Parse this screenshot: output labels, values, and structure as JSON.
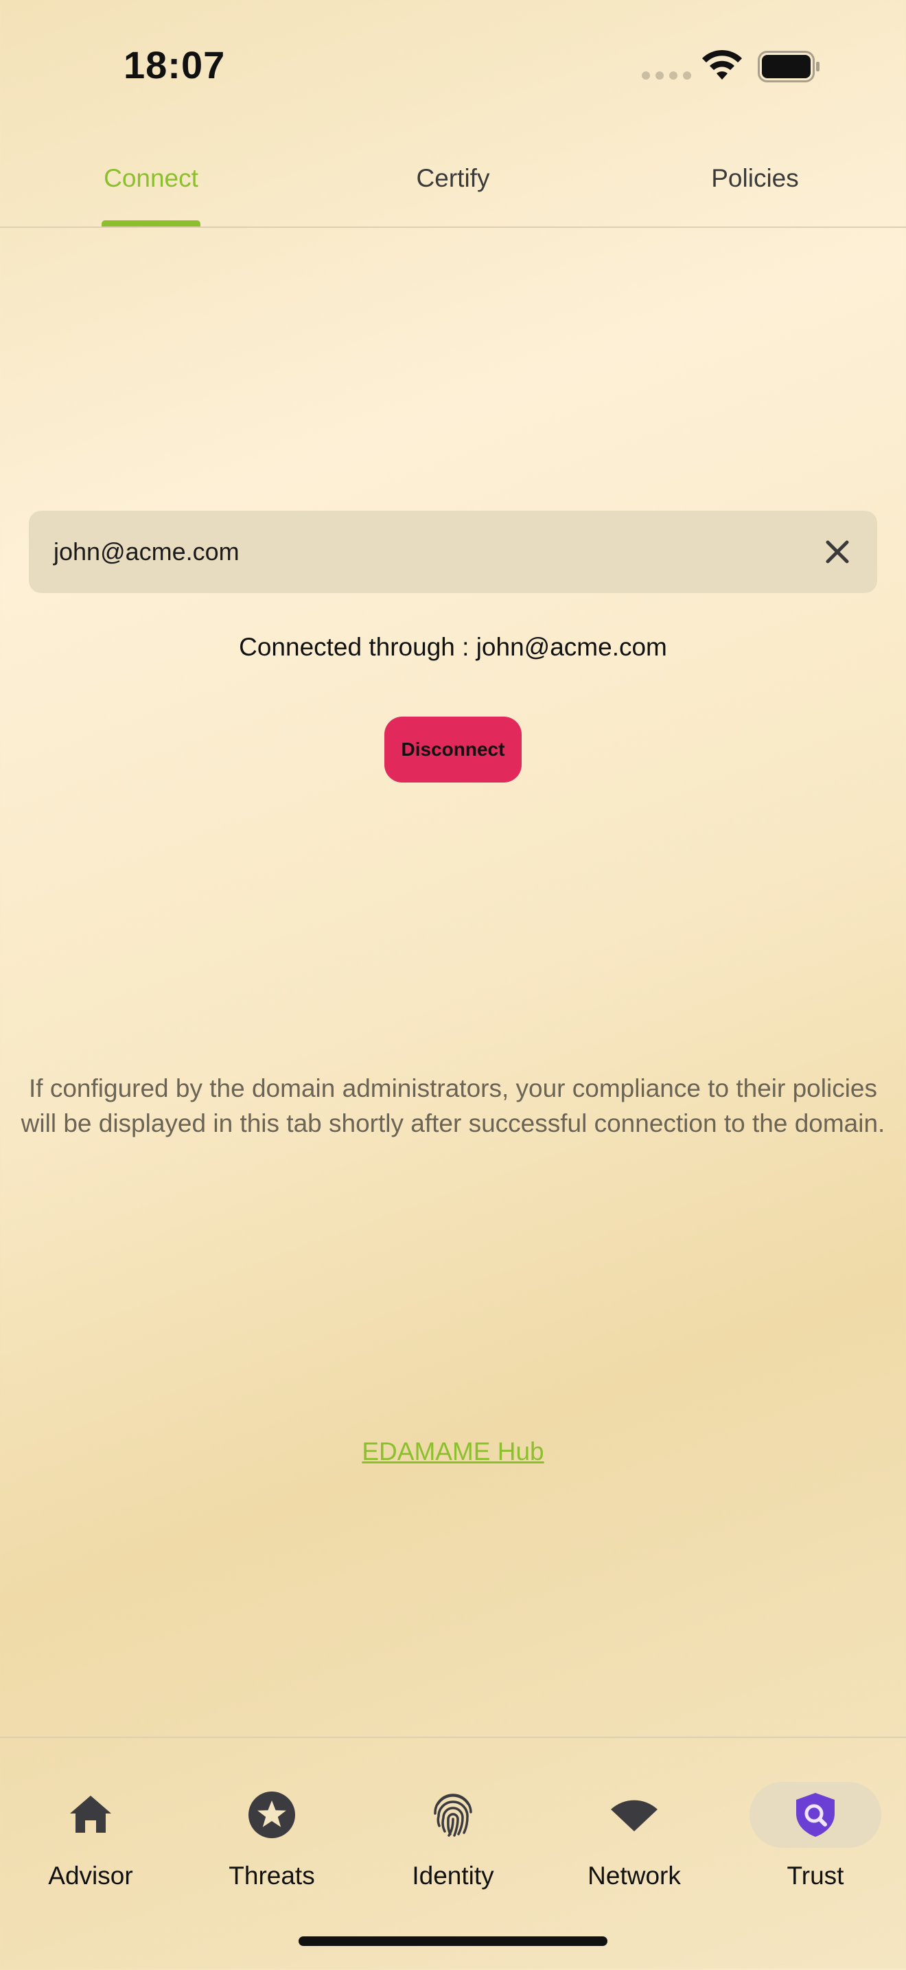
{
  "status_bar": {
    "time": "18:07"
  },
  "top_tabs": [
    {
      "label": "Connect",
      "active": true
    },
    {
      "label": "Certify",
      "active": false
    },
    {
      "label": "Policies",
      "active": false
    }
  ],
  "connect": {
    "email_value": "john@acme.com",
    "connected_text": "Connected through : john@acme.com",
    "disconnect_label": "Disconnect",
    "info_text": "If configured by the domain administrators, your compliance to their policies will be displayed in this tab shortly after successful connection to the domain.",
    "hub_link": "EDAMAME Hub"
  },
  "bottom_nav": [
    {
      "label": "Advisor",
      "icon": "home-icon",
      "active": false
    },
    {
      "label": "Threats",
      "icon": "star-circle-icon",
      "active": false
    },
    {
      "label": "Identity",
      "icon": "fingerprint-icon",
      "active": false
    },
    {
      "label": "Network",
      "icon": "wifi-icon",
      "active": false
    },
    {
      "label": "Trust",
      "icon": "shield-search-icon",
      "active": true
    }
  ],
  "colors": {
    "accent_green": "#8cbf2e",
    "disconnect_red": "#e1295b",
    "trust_purple": "#6b3fd4"
  }
}
